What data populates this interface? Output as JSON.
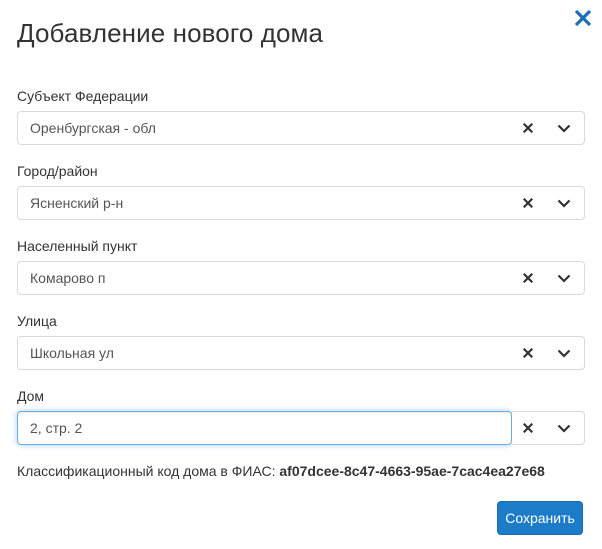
{
  "modal": {
    "title": "Добавление нового дома",
    "close_icon": "close-icon"
  },
  "fields": [
    {
      "label": "Субъект Федерации",
      "value": "Оренбургская - обл"
    },
    {
      "label": "Город/район",
      "value": "Ясненский р-н"
    },
    {
      "label": "Населенный пункт",
      "value": "Комарово п"
    },
    {
      "label": "Улица",
      "value": "Школьная ул"
    }
  ],
  "house": {
    "label": "Дом",
    "value": "2, стр. 2"
  },
  "fias": {
    "label": "Классификационный код дома в ФИАС:",
    "code": "af07dcee-8c47-4663-95ae-7cac4ea27e68"
  },
  "actions": {
    "save_label": "Сохранить"
  },
  "colors": {
    "accent": "#1d7cc8",
    "close": "#1a6fb5",
    "focus_border": "#66afe9"
  },
  "icons": {
    "clear": "clear-x-icon",
    "dropdown": "chevron-down-icon"
  }
}
